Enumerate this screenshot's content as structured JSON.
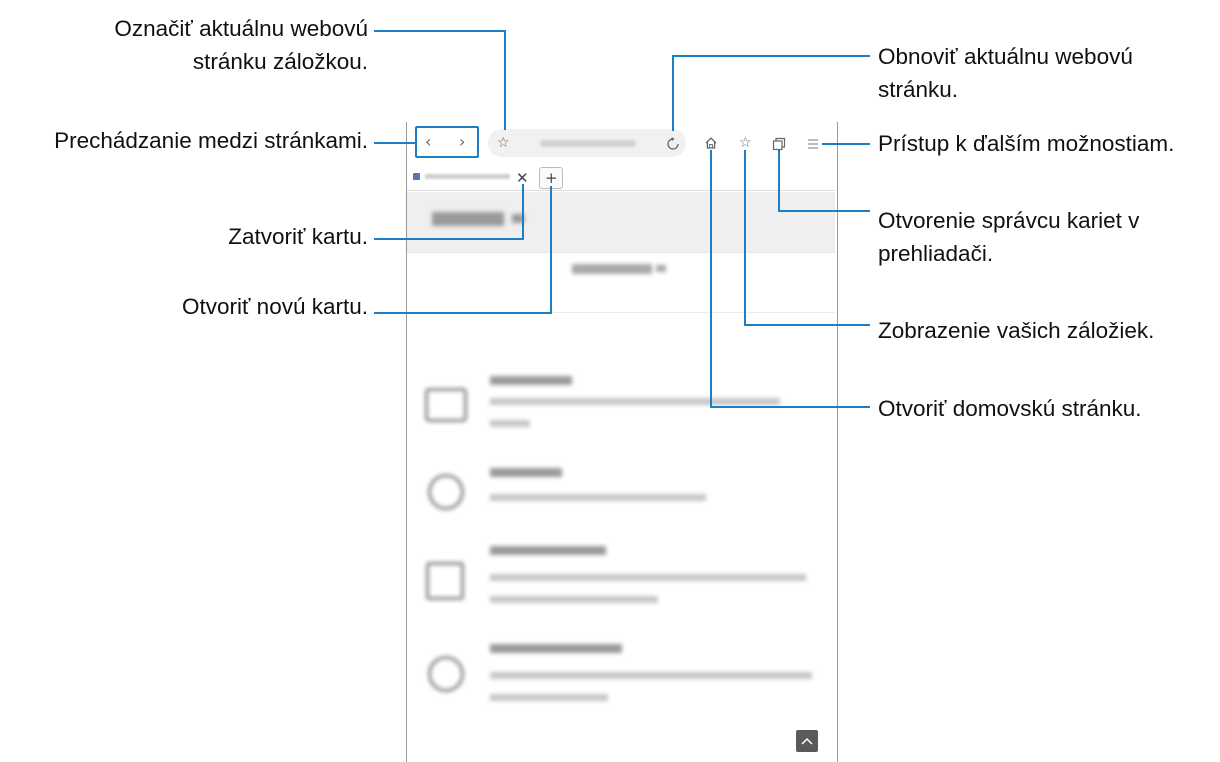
{
  "callouts": {
    "bookmark_current": "Označiť aktuálnu webovú stránku záložkou.",
    "navigate": "Prechádzanie medzi stránkami.",
    "close_tab": "Zatvoriť kartu.",
    "new_tab": "Otvoriť novú kartu.",
    "refresh": "Obnoviť aktuálnu webovú stránku.",
    "more_options": "Prístup k ďalším možnostiam.",
    "tab_manager": "Otvorenie správcu kariet v prehliadači.",
    "view_bookmarks": "Zobrazenie vašich záložiek.",
    "home": "Otvoriť domovskú stránku."
  },
  "colors": {
    "leader": "#1a7fc4",
    "icon": "#666666",
    "scroll_button": "#5a5a5a"
  },
  "icons": {
    "back": "chevron-left-icon",
    "forward": "chevron-right-icon",
    "bookmark_add": "star-icon",
    "refresh": "refresh-icon",
    "home": "home-icon",
    "bookmarks": "star-outline-icon",
    "tabs": "tabs-icon",
    "menu": "menu-icon",
    "close_tab": "close-icon",
    "new_tab": "plus-icon",
    "scroll_top": "chevron-up-icon"
  }
}
